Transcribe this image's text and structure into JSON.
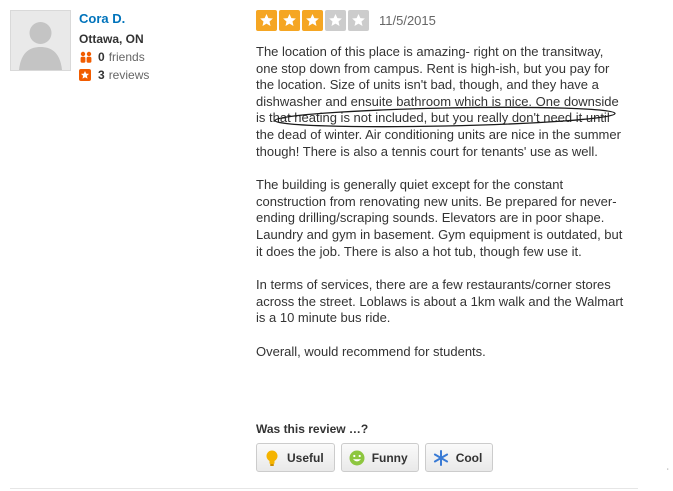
{
  "user": {
    "name": "Cora D.",
    "location": "Ottawa, ON",
    "friends_count": "0",
    "friends_label": "friends",
    "reviews_count": "3",
    "reviews_label": "reviews"
  },
  "review": {
    "rating": 3,
    "max_rating": 5,
    "date": "11/5/2015",
    "paragraphs": [
      "The location of this place is amazing- right on the transitway, one stop down from campus. Rent is high-ish, but you pay for the location. Size of units isn't bad, though, and they have a dishwasher and ensuite bathroom which is nice. One downside is that heating is not included, but you really don't need it until the dead of winter. Air conditioning units are nice in the summer though! There is also a tennis court for tenants' use as well.",
      "The building is generally quiet except for the constant construction from renovating new units. Be prepared for never-ending drilling/scraping sounds. Elevators are in poor shape. Laundry and gym in basement. Gym equipment is outdated, but it does the job. There is also a hot tub, though few use it.",
      "In terms of services, there are a few restaurants/corner stores across the street. Loblaws is about a 1km walk and the Walmart is a 10 minute bus ride.",
      "Overall, would recommend for students."
    ]
  },
  "feedback": {
    "prompt": "Was this review …?",
    "buttons": [
      {
        "label": "Useful",
        "icon": "lightbulb-icon"
      },
      {
        "label": "Funny",
        "icon": "smiley-icon"
      },
      {
        "label": "Cool",
        "icon": "snowflake-icon"
      }
    ]
  },
  "colors": {
    "accent_link": "#0073bb",
    "star_on": "#f5a623",
    "star_off": "#cccccc",
    "review_icon": "#f15c00"
  }
}
